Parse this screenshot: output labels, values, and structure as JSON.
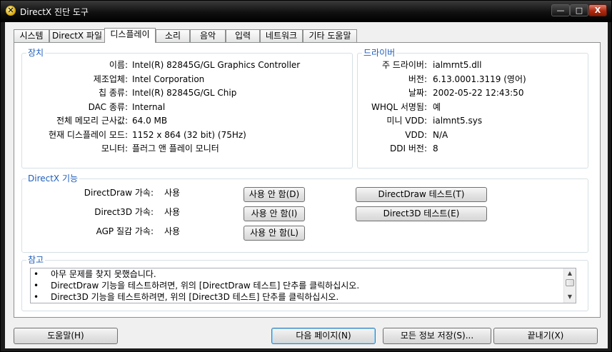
{
  "window": {
    "title": "DirectX 진단 도구",
    "icon_symbol": "✕",
    "controls": {
      "minimize": "—",
      "maximize": "□",
      "close": "X"
    }
  },
  "tabs": [
    {
      "label": "시스템"
    },
    {
      "label": "DirectX 파일"
    },
    {
      "label": "디스플레이",
      "active": true
    },
    {
      "label": "소리"
    },
    {
      "label": "음악"
    },
    {
      "label": "입력"
    },
    {
      "label": "네트워크"
    },
    {
      "label": "기타 도움말"
    }
  ],
  "device": {
    "title": "장치",
    "rows": [
      {
        "label": "이름:",
        "value": "Intel(R) 82845G/GL Graphics Controller"
      },
      {
        "label": "제조업체:",
        "value": "Intel Corporation"
      },
      {
        "label": "칩 종류:",
        "value": "Intel(R) 82845G/GL Chip"
      },
      {
        "label": "DAC 종류:",
        "value": "Internal"
      },
      {
        "label": "전체 메모리 근사값:",
        "value": "64.0 MB"
      },
      {
        "label": "현재 디스플레이 모드:",
        "value": "1152 x 864 (32 bit) (75Hz)"
      },
      {
        "label": "모니터:",
        "value": "플러그 앤 플레이 모니터"
      }
    ]
  },
  "driver": {
    "title": "드라이버",
    "rows": [
      {
        "label": "주 드라이버:",
        "value": "ialmrnt5.dll"
      },
      {
        "label": "버전:",
        "value": "6.13.0001.3119 (영어)"
      },
      {
        "label": "날짜:",
        "value": "2002-05-22 12:43:50"
      },
      {
        "label": "WHQL 서명됨:",
        "value": "예"
      },
      {
        "label": "미니 VDD:",
        "value": "ialmnt5.sys"
      },
      {
        "label": "VDD:",
        "value": "N/A"
      },
      {
        "label": "DDI 버전:",
        "value": "8"
      }
    ]
  },
  "features": {
    "title": "DirectX 기능",
    "rows": [
      {
        "label": "DirectDraw 가속:",
        "value": "사용",
        "disable_button": "사용 안 함(D)",
        "test_button": "DirectDraw 테스트(T)"
      },
      {
        "label": "Direct3D 가속:",
        "value": "사용",
        "disable_button": "사용 안 함(I)",
        "test_button": "Direct3D 테스트(E)"
      },
      {
        "label": "AGP 질감 가속:",
        "value": "사용",
        "disable_button": "사용 안 함(L)"
      }
    ]
  },
  "notes": {
    "title": "참고",
    "bullet": "•",
    "items": [
      "아무 문제를 찾지 못했습니다.",
      "DirectDraw 기능을 테스트하려면, 위의 [DirectDraw 테스트] 단추를 클릭하십시오.",
      "Direct3D 기능을 테스트하려면, 위의 [Direct3D 테스트] 단추를 클릭하십시오."
    ],
    "scroll_up": "▲",
    "scroll_down": "▼"
  },
  "footer": {
    "help": "도움말(H)",
    "next_page": "다음 페이지(N)",
    "save_all": "모든 정보 저장(S)...",
    "exit": "끝내기(X)"
  }
}
